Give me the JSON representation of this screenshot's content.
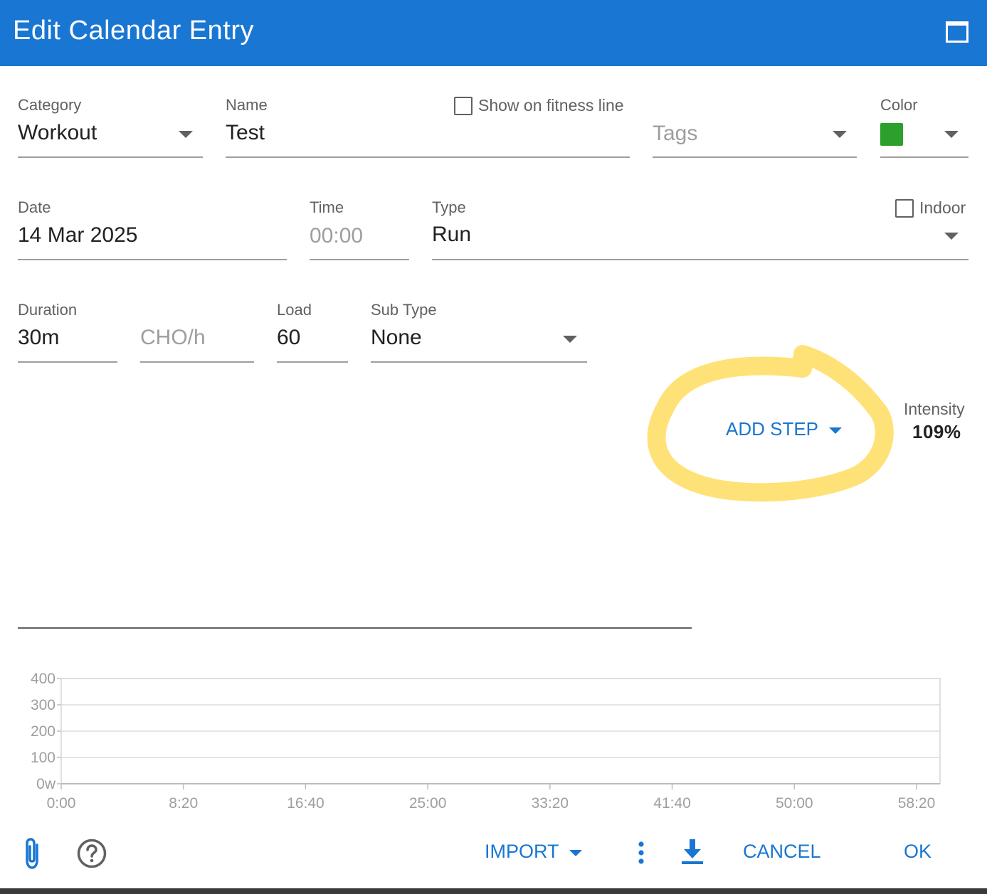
{
  "window": {
    "title": "Edit Calendar Entry"
  },
  "form": {
    "category": {
      "label": "Category",
      "value": "Workout"
    },
    "name": {
      "label": "Name",
      "value": "Test"
    },
    "fitness_line": {
      "label": "Show on fitness line",
      "checked": false
    },
    "tags": {
      "placeholder": "Tags"
    },
    "color": {
      "label": "Color",
      "value": "#2ca02c"
    },
    "date": {
      "label": "Date",
      "value": "14 Mar 2025"
    },
    "time": {
      "label": "Time",
      "placeholder": "00:00"
    },
    "type": {
      "label": "Type",
      "value": "Run"
    },
    "indoor": {
      "label": "Indoor",
      "checked": false
    },
    "duration": {
      "label": "Duration",
      "value": "30m"
    },
    "cho": {
      "placeholder": "CHO/h"
    },
    "load": {
      "label": "Load",
      "value": "60"
    },
    "subtype": {
      "label": "Sub Type",
      "value": "None"
    }
  },
  "workout": {
    "add_step_label": "ADD STEP",
    "intensity_label": "Intensity",
    "intensity_value": "109%"
  },
  "chart_data": {
    "type": "area",
    "y_ticks": [
      "400",
      "300",
      "200",
      "100",
      "0w"
    ],
    "y_values": [
      400,
      300,
      200,
      100,
      0
    ],
    "x_ticks": [
      "0:00",
      "8:20",
      "16:40",
      "25:00",
      "33:20",
      "41:40",
      "50:00",
      "58:20"
    ],
    "x_values_seconds": [
      0,
      500,
      1000,
      1500,
      2000,
      2500,
      3000,
      3500
    ],
    "ylim": [
      0,
      400
    ],
    "xlim": [
      0,
      3500
    ],
    "series": [],
    "grid": true
  },
  "footer": {
    "import_label": "IMPORT",
    "cancel_label": "CANCEL",
    "ok_label": "OK"
  },
  "colors": {
    "primary": "#1976d2",
    "highlight": "#ffd84a"
  },
  "icons": {
    "attach": "paperclip-icon",
    "help": "help-circle-icon",
    "more": "more-vert-icon",
    "download": "download-icon",
    "maximize": "maximize-icon"
  }
}
